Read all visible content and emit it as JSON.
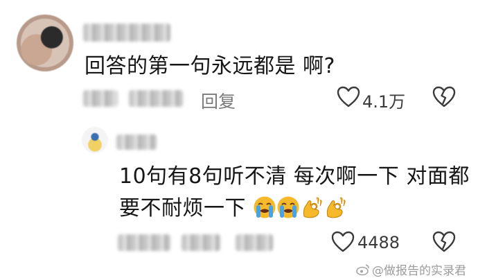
{
  "comment": {
    "text": "回答的第一句永远都是 啊?",
    "reply_label": "回复",
    "like_count": "4.1万"
  },
  "reply": {
    "line1": "10句有8句听不清 每次啊一下 对面都",
    "line2": "要不耐烦一下",
    "emojis": [
      "loudly-crying-face",
      "loudly-crying-face",
      "ok-hand",
      "ok-hand"
    ],
    "like_count": "4488"
  },
  "watermark": {
    "text": "@做报告的实录君"
  },
  "colors": {
    "text": "#161616",
    "meta": "#7a7a7a",
    "icon": "#3a3a3a",
    "emoji_yellow": "#f6b92b",
    "tear_blue": "#4aa3e0"
  }
}
